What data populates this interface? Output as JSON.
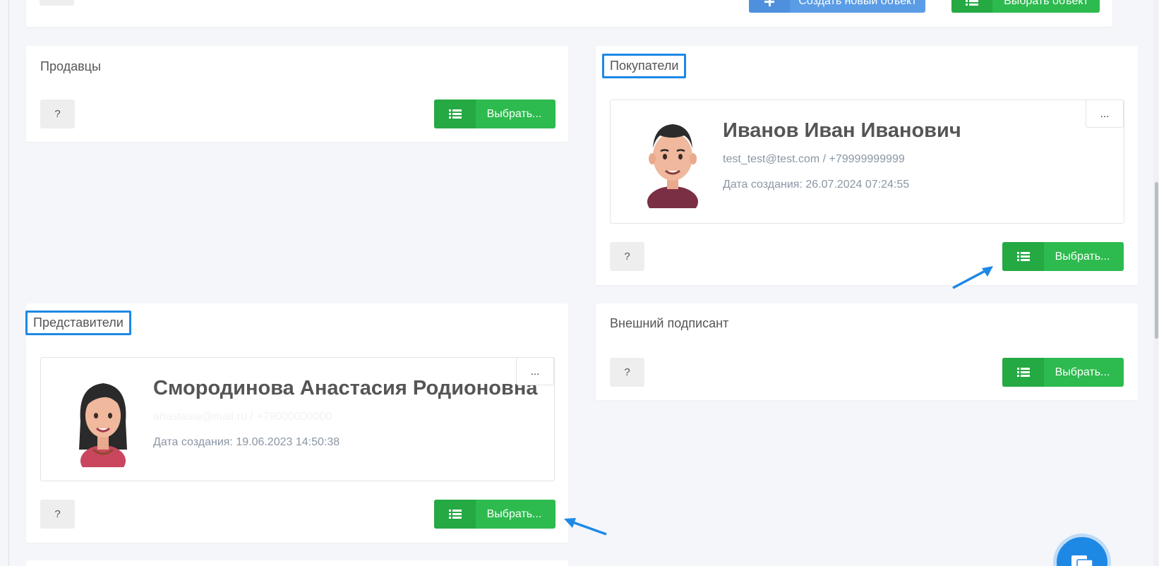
{
  "top_bar": {
    "help_label": "?",
    "create_new_label": "Создать новый объект",
    "select_object_label": "Выбрать объект"
  },
  "sellers": {
    "title": "Продавцы",
    "help_label": "?",
    "select_label": "Выбрать..."
  },
  "buyers": {
    "title": "Покупатели",
    "help_label": "?",
    "select_label": "Выбрать...",
    "card": {
      "name": "Иванов Иван Иванович",
      "contact": "test_test@test.com / +79999999999",
      "created": "Дата создания: 26.07.2024 07:24:55",
      "more_label": "..."
    }
  },
  "representatives": {
    "title": "Представители",
    "help_label": "?",
    "select_label": "Выбрать...",
    "card": {
      "name": "Смородинова Анастасия Родионовна",
      "contact": "anastasia@mail.ru / +79000000000",
      "created": "Дата создания: 19.06.2023 14:50:38",
      "more_label": "..."
    }
  },
  "external_signer": {
    "title": "Внешний подписант",
    "help_label": "?",
    "select_label": "Выбрать..."
  },
  "colors": {
    "accent_green": "#2dba4e",
    "accent_blue": "#1e88e5",
    "background": "#f4f6fa"
  },
  "icons": [
    "list-icon",
    "plus-icon",
    "chat-icon",
    "arrow-annotation",
    "avatar-male",
    "avatar-female"
  ]
}
